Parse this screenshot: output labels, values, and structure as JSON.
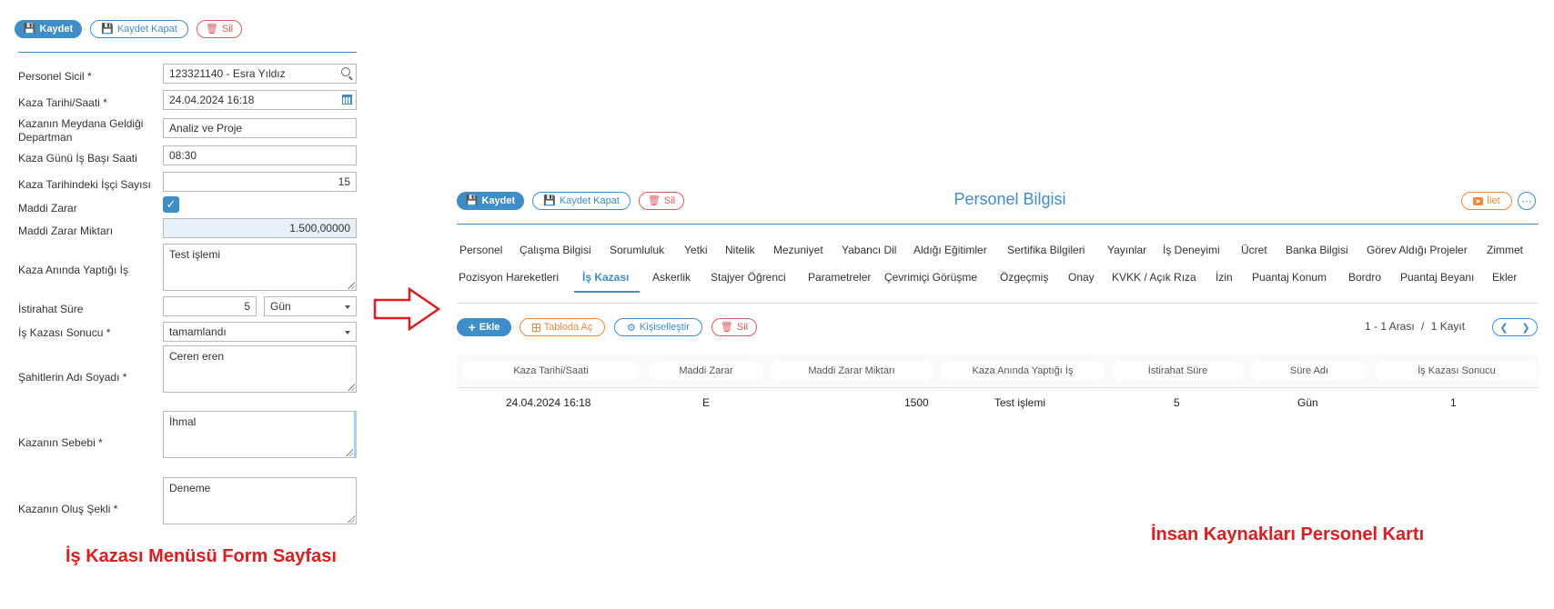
{
  "form": {
    "toolbar": {
      "save": "Kaydet",
      "save_close": "Kaydet Kapat",
      "delete": "Sil"
    },
    "fields": {
      "personel_sicil": {
        "label": "Personel Sicil *",
        "value": "123321140 - Esra Yıldız"
      },
      "kaza_tarihi": {
        "label": "Kaza Tarihi/Saati *",
        "value": "24.04.2024 16:18"
      },
      "departman": {
        "label_line1": "Kazanın Meydana Geldiği",
        "label_line2": "Departman",
        "value": "Analiz ve Proje"
      },
      "is_basi": {
        "label": "Kaza Günü İş Başı Saati",
        "value": "08:30"
      },
      "isci_sayisi": {
        "label": "Kaza Tarihindeki İşçi Sayısı",
        "value": "15"
      },
      "maddi_zarar": {
        "label": "Maddi Zarar",
        "checked": true
      },
      "maddi_zarar_miktari": {
        "label": "Maddi Zarar Miktarı",
        "value": "1.500,00000"
      },
      "yaptigi_is": {
        "label": "Kaza Anında Yaptığı İş",
        "value": "Test işlemi"
      },
      "istirahat": {
        "label": "İstirahat Süre",
        "value": "5",
        "unit": "Gün"
      },
      "sonuc": {
        "label": "İş Kazası Sonucu *",
        "value": "tamamlandı"
      },
      "sahitler": {
        "label": "Şahitlerin Adı Soyadı *",
        "value": "Ceren eren"
      },
      "sebep": {
        "label": "Kazanın Sebebi *",
        "value": "İhmal"
      },
      "olus": {
        "label": "Kazanın Oluş Şekli *",
        "value": "Deneme"
      }
    }
  },
  "captions": {
    "left": "İş Kazası Menüsü Form Sayfası",
    "right": "İnsan Kaynakları Personel Kartı"
  },
  "card": {
    "toolbar": {
      "save": "Kaydet",
      "save_close": "Kaydet Kapat",
      "delete": "Sil",
      "forward": "İlet"
    },
    "title": "Personel Bilgisi",
    "tabs_row1": [
      "Personel",
      "Çalışma Bilgisi",
      "Sorumluluk",
      "Yetki",
      "Nitelik",
      "Mezuniyet",
      "Yabancı Dil",
      "Aldığı Eğitimler",
      "Sertifika Bilgileri",
      "Yayınlar",
      "İş Deneyimi",
      "Ücret",
      "Banka Bilgisi",
      "Görev Aldığı Projeler",
      "Zimmet"
    ],
    "tabs_row2": [
      "Pozisyon Hareketleri",
      "İş Kazası",
      "Askerlik",
      "Stajyer Öğrenci",
      "Parametreler",
      "Çevrimiçi Görüşme",
      "Özgeçmiş",
      "Onay",
      "KVKK / Açık Rıza",
      "İzin",
      "Puantaj Konum",
      "Bordro",
      "Puantaj Beyanı",
      "Ekler"
    ],
    "active_tab": "İş Kazası",
    "actions": {
      "add": "Ekle",
      "open_table": "Tabloda Aç",
      "customize": "Kişiselleştir",
      "delete": "Sil"
    },
    "pagination": {
      "range": "1 - 1 Arası",
      "separator": "/",
      "count": "1 Kayıt"
    },
    "table": {
      "headers": [
        "Kaza Tarihi/Saati",
        "Maddi Zarar",
        "Maddi Zarar Miktarı",
        "Kaza Anında Yaptığı İş",
        "İstirahat Süre",
        "Süre Adı",
        "İş Kazası Sonucu"
      ],
      "rows": [
        [
          "24.04.2024 16:18",
          "E",
          "1500",
          "Test işlemi",
          "5",
          "Gün",
          "1"
        ]
      ]
    }
  },
  "colors": {
    "accent": "#3d8ec9",
    "danger": "#e05a5a",
    "orange": "#f0883a",
    "caption": "#e01c1c"
  }
}
